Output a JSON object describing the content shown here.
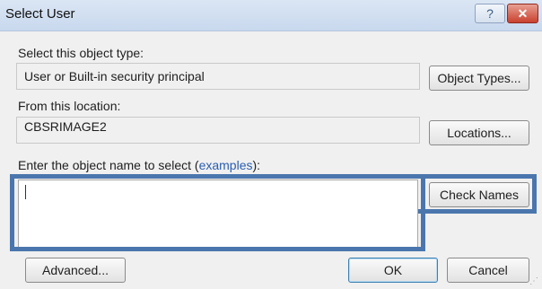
{
  "window": {
    "title": "Select User",
    "help_glyph": "?",
    "close_glyph": "✕"
  },
  "object_type": {
    "label": "Select this object type:",
    "value": "User or Built-in security principal",
    "button": "Object Types..."
  },
  "location": {
    "label": "From this location:",
    "value": "CBSRIMAGE2",
    "button": "Locations..."
  },
  "object_name": {
    "label_prefix": "Enter the object name to select (",
    "link": "examples",
    "label_suffix": "):",
    "value": "",
    "check_button": "Check Names"
  },
  "footer": {
    "advanced_button": "Advanced...",
    "ok_button": "OK",
    "cancel_button": "Cancel"
  },
  "colors": {
    "highlight": "#4a76ad",
    "link": "#2a5db0",
    "close": "#c9412f"
  },
  "icons": {
    "help": "question-mark-icon",
    "close": "close-icon",
    "grip": "resize-grip-icon"
  }
}
